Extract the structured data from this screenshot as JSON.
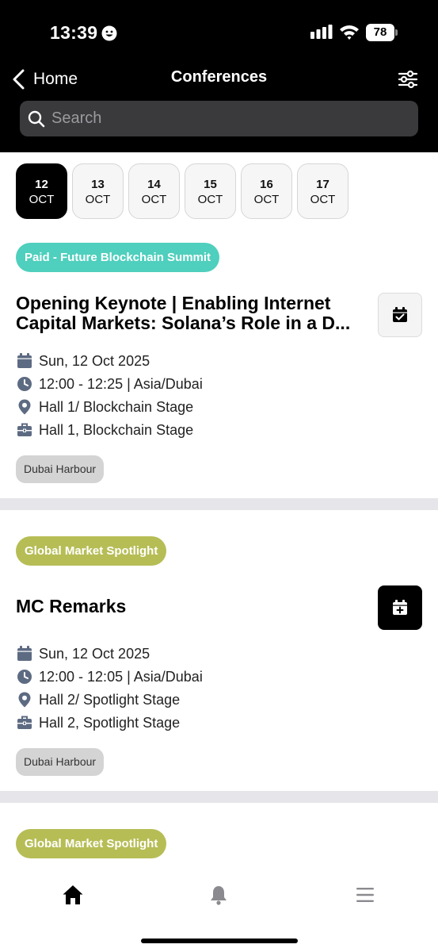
{
  "status_bar": {
    "time": "13:39",
    "battery": "78"
  },
  "nav": {
    "back_label": "Home",
    "title": "Conferences"
  },
  "search": {
    "placeholder": "Search"
  },
  "dates": [
    {
      "day": "12",
      "month": "OCT",
      "active": true
    },
    {
      "day": "13",
      "month": "OCT",
      "active": false
    },
    {
      "day": "14",
      "month": "OCT",
      "active": false
    },
    {
      "day": "15",
      "month": "OCT",
      "active": false
    },
    {
      "day": "16",
      "month": "OCT",
      "active": false
    },
    {
      "day": "17",
      "month": "OCT",
      "active": false
    }
  ],
  "events": [
    {
      "tag": "Paid - Future Blockchain Summit",
      "tag_color": "#4fcfbd",
      "title_lines": [
        "Opening Keynote | Enabling Internet",
        "Capital Markets: Solana’s Role in a D..."
      ],
      "calendar_state": "added",
      "date": "Sun, 12 Oct 2025",
      "time": "12:00 - 12:25 | Asia/Dubai",
      "location": "Hall 1/ Blockchain Stage",
      "room": "Hall 1, Blockchain Stage",
      "venue": "Dubai Harbour"
    },
    {
      "tag": "Global Market Spotlight",
      "tag_color": "#b6bd55",
      "title_lines": [
        "MC Remarks"
      ],
      "calendar_state": "add",
      "date": "Sun, 12 Oct 2025",
      "time": "12:00 - 12:05 | Asia/Dubai",
      "location": "Hall 2/ Spotlight Stage",
      "room": "Hall 2, Spotlight Stage",
      "venue": "Dubai Harbour"
    },
    {
      "tag": "Global Market Spotlight",
      "tag_color": "#b6bd55"
    }
  ],
  "tab_bar": {
    "icons": [
      "home-icon",
      "bell-icon",
      "menu-icon"
    ]
  },
  "colors": {
    "header_bg": "#000000",
    "icon_slate": "#5d6b82",
    "separator": "#e5e5ea"
  }
}
